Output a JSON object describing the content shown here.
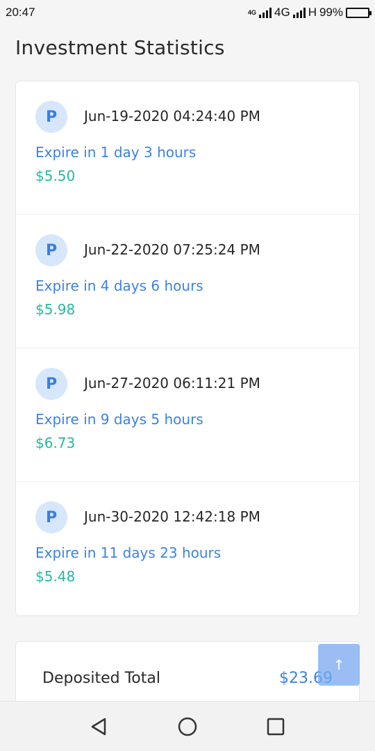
{
  "status_bar": {
    "time": "20:47",
    "net_top": "4G",
    "net_primary": "4G",
    "net_secondary": "H",
    "battery": "99%",
    "battery_level": 0.99
  },
  "page": {
    "title": "Investment Statistics"
  },
  "investments": [
    {
      "avatar_letter": "P",
      "date": "Jun-19-2020 04:24:40 PM",
      "expire": "Expire in 1 day 3 hours",
      "amount": "$5.50"
    },
    {
      "avatar_letter": "P",
      "date": "Jun-22-2020 07:25:24 PM",
      "expire": "Expire in 4 days 6 hours",
      "amount": "$5.98"
    },
    {
      "avatar_letter": "P",
      "date": "Jun-27-2020 06:11:21 PM",
      "expire": "Expire in 9 days 5 hours",
      "amount": "$6.73"
    },
    {
      "avatar_letter": "P",
      "date": "Jun-30-2020 12:42:18 PM",
      "expire": "Expire in 11 days 23 hours",
      "amount": "$5.48"
    }
  ],
  "totals": {
    "deposited_label": "Deposited Total",
    "deposited_value": "$23.69"
  },
  "scroll_top": {
    "icon": "arrow-up-icon",
    "glyph": "↑"
  },
  "nav": {
    "back": "back-triangle-icon",
    "home": "home-circle-icon",
    "recents": "recents-square-icon"
  },
  "colors": {
    "accent": "#3b83e0",
    "amount": "#27b8a0",
    "avatar_bg": "#d6e7fb"
  }
}
